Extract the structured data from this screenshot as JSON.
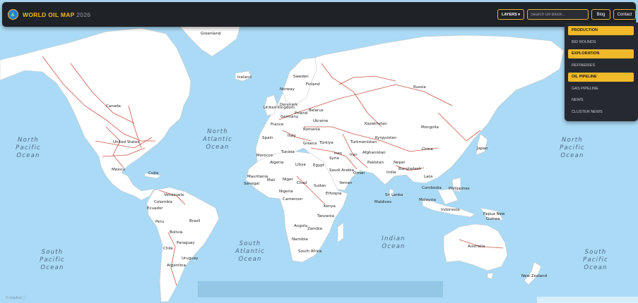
{
  "app": {
    "title": "WORLD OIL MAP",
    "year": "2026"
  },
  "header": {
    "layers_label": "LAYERS ▾",
    "search_placeholder": "Search Oil Block...",
    "blog_label": "Blog",
    "contact_label": "Contact"
  },
  "layers_menu": [
    {
      "label": "PRODUCTION",
      "active": true
    },
    {
      "label": "BID ROUNDS",
      "active": false
    },
    {
      "label": "EXPLORATION",
      "active": true
    },
    {
      "label": "REFINERIES",
      "active": false
    },
    {
      "label": "OIL PIPELINE",
      "active": true
    },
    {
      "label": "GAS PIPELINE",
      "active": false
    },
    {
      "label": "NEWS",
      "active": false
    },
    {
      "label": "CLUSTER NEWS",
      "active": false
    }
  ],
  "oceans": {
    "north_pacific_w": [
      "North",
      "Pacific",
      "Ocean"
    ],
    "north_atlantic": [
      "North",
      "Atlantic",
      "Ocean"
    ],
    "north_pacific_e": [
      "North",
      "Pacific",
      "Ocean"
    ],
    "south_pacific_w": [
      "South",
      "Pacific",
      "Ocean"
    ],
    "south_atlantic": [
      "South",
      "Atlantic",
      "Ocean"
    ],
    "indian": [
      "Indian",
      "Ocean"
    ],
    "south_pacific_e": [
      "South",
      "Pacific",
      "Ocean"
    ]
  },
  "countries": {
    "greenland": "Greenland",
    "iceland": "Iceland",
    "canada": "Canada",
    "united_states": "United States",
    "mexico": "Mexico",
    "cuba": "Cuba",
    "venezuela": "Venezuela",
    "colombia": "Colombia",
    "ecuador": "Ecuador",
    "peru": "Peru",
    "brazil": "Brazil",
    "bolivia": "Bolivia",
    "paraguay": "Paraguay",
    "chile": "Chile",
    "uruguay": "Uruguay",
    "argentina": "Argentina",
    "sweden": "Sweden",
    "norway": "Norway",
    "finland": "Finland",
    "denmark": "Denmark",
    "united_kingdom": "United Kingdom",
    "germany": "Germany",
    "poland": "Poland",
    "belarus": "Belarus",
    "france": "France",
    "ukraine": "Ukraine",
    "romania": "Romania",
    "spain": "Spain",
    "italy": "Italy",
    "greece": "Greece",
    "turkiye": "Türkiye",
    "morocco": "Morocco",
    "tunisia": "Tunisia",
    "algeria": "Algeria",
    "libya": "Libya",
    "egypt": "Egypt",
    "mauritania": "Mauritania",
    "mali": "Mali",
    "niger": "Niger",
    "chad": "Chad",
    "sudan": "Sudan",
    "senegal": "Senegal",
    "nigeria": "Nigeria",
    "cameroon": "Cameroon",
    "ethiopia": "Ethiopia",
    "kenya": "Kenya",
    "tanzania": "Tanzania",
    "angola": "Angola",
    "zambia": "Zambia",
    "namibia": "Namibia",
    "south_africa": "South Africa",
    "russia": "Russia",
    "kazakhstan": "Kazakhstan",
    "mongolia": "Mongolia",
    "china": "China",
    "japan": "Japan",
    "turkmenistan": "Turkmenistan",
    "kyrgyzstan": "Kyrgyzstan",
    "afghanistan": "Afghanistan",
    "iran": "Iran",
    "iraq": "Iraq",
    "syria": "Syria",
    "saudi_arabia": "Saudi Arabia",
    "oman": "Oman",
    "yemen": "Yemen",
    "pakistan": "Pakistan",
    "nepal": "Nepal",
    "india": "India",
    "bangladesh": "Bangladesh",
    "laos": "Laos",
    "cambodia": "Cambodia",
    "philippines": "Philippines",
    "sri_lanka": "Sri Lanka",
    "maldives": "Maldives",
    "malaysia": "Malaysia",
    "indonesia": "Indonesia",
    "papua_new_guinea": [
      "Papua New",
      "Guinea"
    ],
    "australia": "Australia",
    "new_zealand": "New Zealand"
  },
  "attribution": "© mapbox ⓘ",
  "colors": {
    "accent": "#f0b929",
    "ocean": "#aadaf5",
    "pipeline": "#c0392b",
    "bar": "#1f2227"
  }
}
